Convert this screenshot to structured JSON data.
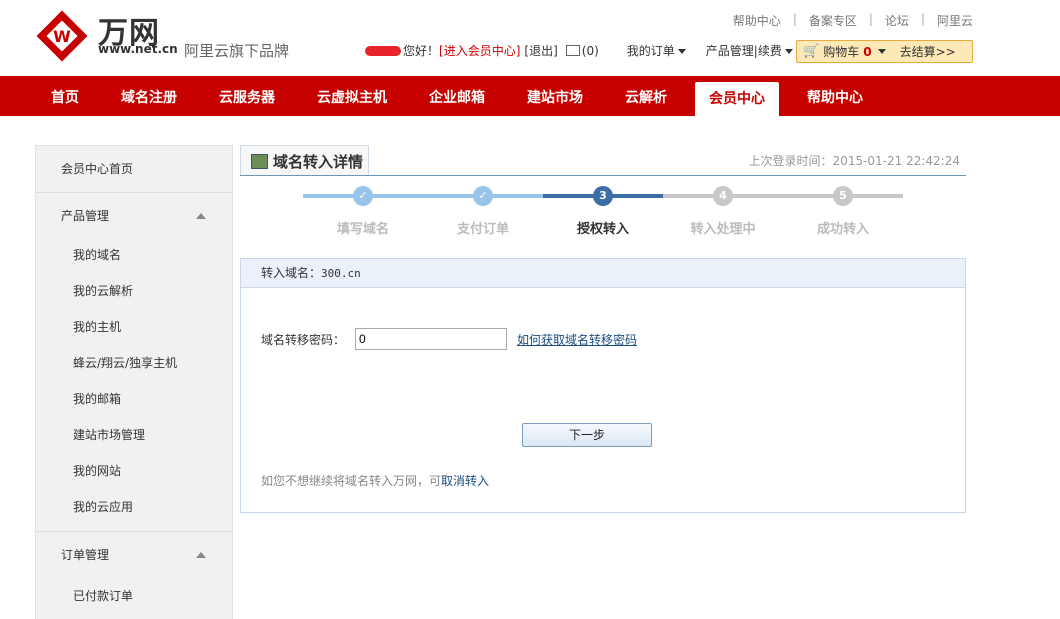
{
  "brand": {
    "name": "万网",
    "url": "www.net.cn",
    "slogan": "阿里云旗下品牌",
    "color": "#c70000"
  },
  "top_links": [
    "帮助中心",
    "备案专区",
    "论坛",
    "阿里云"
  ],
  "user_bar": {
    "greeting": "您好！",
    "member_center_link": "[进入会员中心]",
    "logout_link": "[退出]",
    "message_count": "(0)",
    "my_orders": "我的订单",
    "product_management": "产品管理|续费"
  },
  "cart": {
    "label": "购物车",
    "count": "0",
    "checkout": "去结算>>"
  },
  "nav": {
    "items": [
      "首页",
      "域名注册",
      "云服务器",
      "云虚拟主机",
      "企业邮箱",
      "建站市场",
      "云解析",
      "会员中心",
      "帮助中心"
    ],
    "active": "会员中心"
  },
  "sidebar": {
    "home": "会员中心首页",
    "product_group": "产品管理",
    "product_items": [
      "我的域名",
      "我的云解析",
      "我的主机",
      "蜂云/翔云/独享主机",
      "我的邮箱",
      "建站市场管理",
      "我的网站",
      "我的云应用"
    ],
    "order_group": "订单管理",
    "order_items": [
      "已付款订单"
    ]
  },
  "main": {
    "title": "域名转入详情",
    "last_login": "上次登录时间：2015-01-21 22:42:24",
    "steps": [
      "填写域名",
      "支付订单",
      "授权转入",
      "转入处理中",
      "成功转入"
    ],
    "current_step": 3,
    "domain_label": "转入域名：",
    "domain_value": "300.cn",
    "password_label": "域名转移密码：",
    "password_value": "0",
    "help_link": "如何获取域名转移密码",
    "next_button": "下一步",
    "cancel_text": "如您不想继续将域名转入万网，可",
    "cancel_link": "取消转入"
  }
}
